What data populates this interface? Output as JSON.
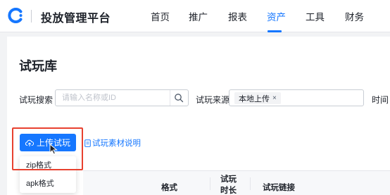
{
  "header": {
    "brand": "投放管理平台",
    "nav": [
      "首页",
      "推广",
      "报表",
      "资产",
      "工具",
      "财务"
    ],
    "active_nav": "资产",
    "accent_color": "#1677ff"
  },
  "page": {
    "title": "试玩库"
  },
  "filters": {
    "search_label": "试玩搜索",
    "search_placeholder": "请输入名称或ID",
    "source_label": "试玩来源",
    "source_tag": "本地上传",
    "time_label": "时间"
  },
  "actions": {
    "upload_label": "上传试玩",
    "doc_link_label": "试玩素材说明",
    "dropdown_items": [
      "zip格式",
      "apk格式"
    ]
  },
  "table": {
    "columns": [
      "格式",
      "试玩时长",
      "试玩链接"
    ]
  },
  "icons": {
    "logo": "logo-icon",
    "search": "search-icon",
    "upload": "cloud-upload-icon",
    "doc": "document-icon",
    "close": "close-icon",
    "cursor": "mouse-cursor-icon"
  },
  "highlight_color": "#e8412f"
}
